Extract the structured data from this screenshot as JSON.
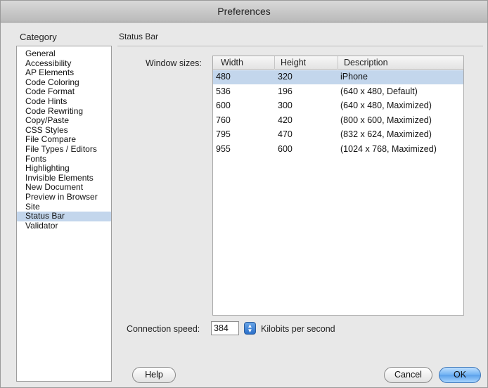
{
  "window": {
    "title": "Preferences"
  },
  "sidebar": {
    "header": "Category",
    "items": [
      {
        "label": "General"
      },
      {
        "label": "Accessibility"
      },
      {
        "label": "AP Elements"
      },
      {
        "label": "Code Coloring"
      },
      {
        "label": "Code Format"
      },
      {
        "label": "Code Hints"
      },
      {
        "label": "Code Rewriting"
      },
      {
        "label": "Copy/Paste"
      },
      {
        "label": "CSS Styles"
      },
      {
        "label": "File Compare"
      },
      {
        "label": "File Types / Editors"
      },
      {
        "label": "Fonts"
      },
      {
        "label": "Highlighting"
      },
      {
        "label": "Invisible Elements"
      },
      {
        "label": "New Document"
      },
      {
        "label": "Preview in Browser"
      },
      {
        "label": "Site"
      },
      {
        "label": "Status Bar"
      },
      {
        "label": "Validator"
      }
    ],
    "selected": "Status Bar"
  },
  "main": {
    "section_title": "Status Bar",
    "window_sizes_label": "Window sizes:",
    "table": {
      "columns": [
        "Width",
        "Height",
        "Description"
      ],
      "rows": [
        {
          "width": "480",
          "height": "320",
          "description": "iPhone"
        },
        {
          "width": "536",
          "height": "196",
          "description": "(640 x 480, Default)"
        },
        {
          "width": "600",
          "height": "300",
          "description": "(640 x 480, Maximized)"
        },
        {
          "width": "760",
          "height": "420",
          "description": "(800 x 600, Maximized)"
        },
        {
          "width": "795",
          "height": "470",
          "description": "(832 x 624, Maximized)"
        },
        {
          "width": "955",
          "height": "600",
          "description": "(1024 x 768, Maximized)"
        }
      ],
      "selected_row": 0
    },
    "connection_speed": {
      "label": "Connection speed:",
      "value": "384",
      "unit": "Kilobits per second"
    }
  },
  "buttons": {
    "help": "Help",
    "cancel": "Cancel",
    "ok": "OK"
  },
  "colors": {
    "selection": "#c3d6ec",
    "default_button": "#6fb1f3"
  }
}
